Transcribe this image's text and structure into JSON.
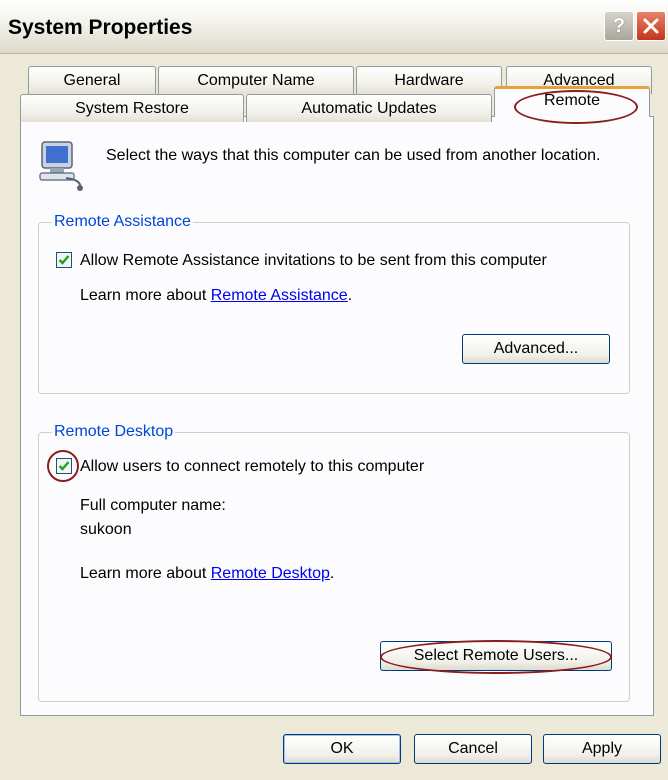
{
  "window": {
    "title": "System Properties",
    "help_label": "?"
  },
  "tabs": {
    "row1": [
      "General",
      "Computer Name",
      "Hardware",
      "Advanced"
    ],
    "row2": [
      "System Restore",
      "Automatic Updates",
      "Remote"
    ],
    "active": "Remote"
  },
  "intro": "Select the ways that this computer can be used from another location.",
  "remote_assistance": {
    "title": "Remote Assistance",
    "checkbox_label": "Allow Remote Assistance invitations to be sent from this computer",
    "checked": true,
    "learn_prefix": "Learn more about ",
    "learn_link": "Remote Assistance",
    "learn_suffix": ".",
    "advanced_button": "Advanced..."
  },
  "remote_desktop": {
    "title": "Remote Desktop",
    "checkbox_label": "Allow users to connect remotely to this computer",
    "checked": true,
    "computer_name_label": "Full computer name:",
    "computer_name": "sukoon",
    "learn_prefix": "Learn more about ",
    "learn_link": "Remote Desktop",
    "learn_suffix": ".",
    "select_users_button": "Select Remote Users..."
  },
  "footer": {
    "ok": "OK",
    "cancel": "Cancel",
    "apply": "Apply"
  },
  "colors": {
    "group_title": "#0046d5",
    "link": "#0000ee",
    "annotation": "#8b1d1d",
    "active_tab_accent": "#e6a239"
  }
}
